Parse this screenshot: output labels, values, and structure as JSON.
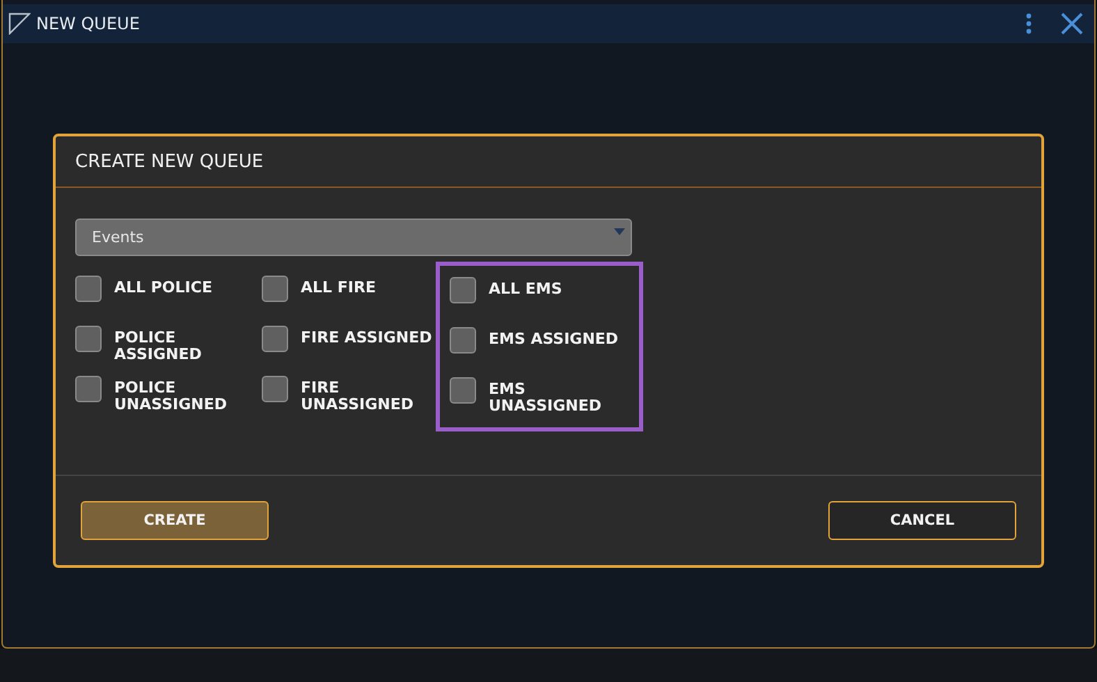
{
  "window": {
    "title": "NEW QUEUE"
  },
  "dialog": {
    "title": "CREATE NEW QUEUE",
    "dropdown": {
      "value": "Events"
    },
    "columns": [
      {
        "highlighted": false,
        "options": [
          {
            "label": "ALL POLICE",
            "checked": false
          },
          {
            "label": "POLICE ASSIGNED",
            "checked": false
          },
          {
            "label": "POLICE UNASSIGNED",
            "checked": false
          }
        ]
      },
      {
        "highlighted": false,
        "options": [
          {
            "label": "ALL FIRE",
            "checked": false
          },
          {
            "label": "FIRE ASSIGNED",
            "checked": false
          },
          {
            "label": "FIRE UNASSIGNED",
            "checked": false
          }
        ]
      },
      {
        "highlighted": true,
        "options": [
          {
            "label": "ALL EMS",
            "checked": false
          },
          {
            "label": "EMS ASSIGNED",
            "checked": false
          },
          {
            "label": "EMS UNASSIGNED",
            "checked": false
          }
        ]
      }
    ],
    "buttons": [
      {
        "label": "CREATE",
        "kind": "primary"
      },
      {
        "label": "CANCEL",
        "kind": "secondary"
      }
    ]
  }
}
